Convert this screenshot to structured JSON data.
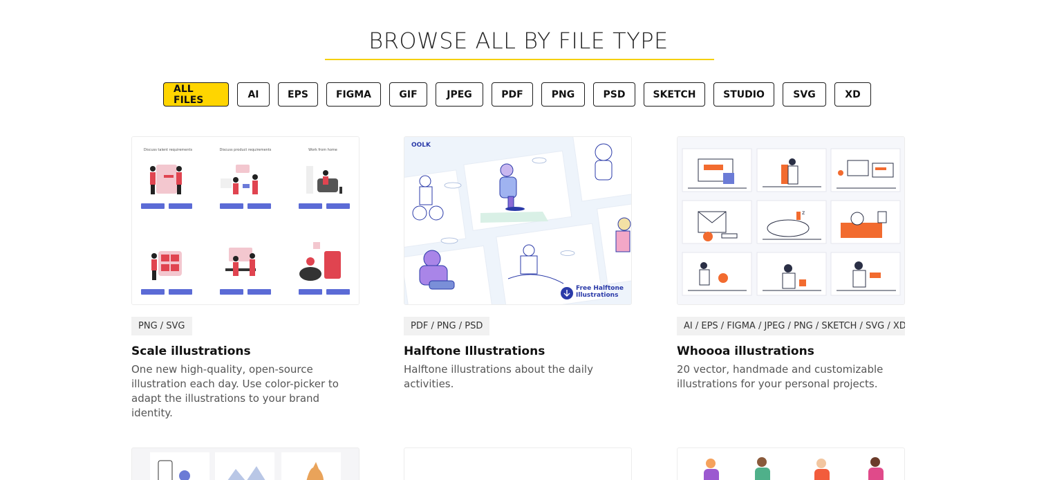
{
  "page": {
    "title": "BROWSE ALL BY FILE TYPE"
  },
  "filters": [
    {
      "label": "ALL FILES",
      "active": true
    },
    {
      "label": "AI"
    },
    {
      "label": "EPS"
    },
    {
      "label": "FIGMA"
    },
    {
      "label": "GIF"
    },
    {
      "label": "JPEG"
    },
    {
      "label": "PDF"
    },
    {
      "label": "PNG"
    },
    {
      "label": "PSD"
    },
    {
      "label": "SKETCH"
    },
    {
      "label": "STUDIO"
    },
    {
      "label": "SVG"
    },
    {
      "label": "XD"
    }
  ],
  "cards": [
    {
      "types": "PNG / SVG",
      "name": "Scale illustrations",
      "desc": "One new high-quality, open-source illustration each day. Use color-picker to adapt the illustrations to your brand identity.",
      "thumb": {
        "captions": [
          "Discuss talent requirements",
          "Discuss product requirements",
          "Work from home"
        ],
        "button_labels": [
          "Download .svg",
          "Download .png"
        ]
      }
    },
    {
      "types": "PDF / PNG / PSD",
      "name": "Halftone Illustrations",
      "desc": "Halftone illustrations about the daily activities.",
      "thumb": {
        "logo": "OOLK",
        "badge": "Free Halftone Illustrations"
      }
    },
    {
      "types": "AI / EPS / FIGMA / JPEG / PNG / SKETCH / SVG / XD",
      "name": "Whoooa illustrations",
      "desc": "20 vector, handmade and customizable illustrations for your personal projects."
    }
  ],
  "colors": {
    "accent": "#ffd500",
    "underline": "#f5d000",
    "tag_bg": "#f1f1f1"
  }
}
